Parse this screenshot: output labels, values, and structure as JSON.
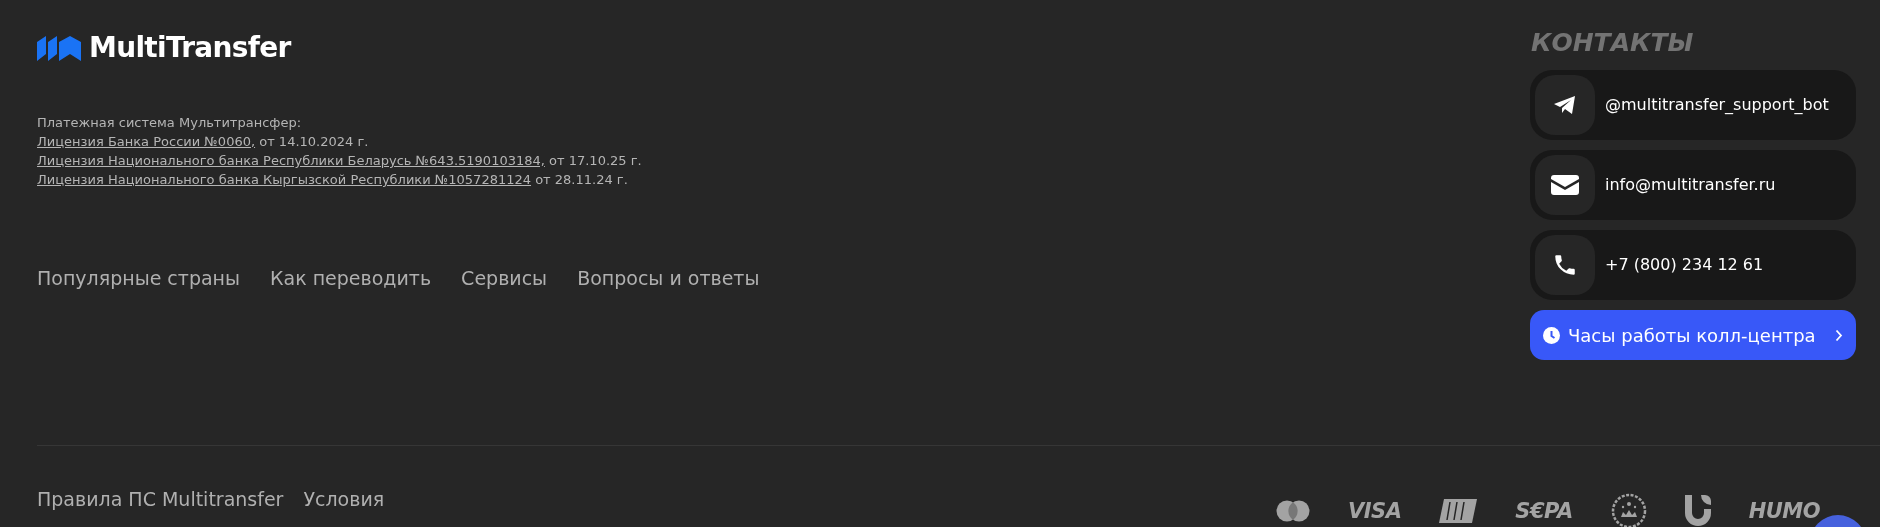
{
  "logo": {
    "text": "MultiTransfer"
  },
  "licenses": {
    "intro": "Платежная система Мультитрансфер:",
    "items": [
      {
        "link": "Лицензия Банка России №0060,",
        "rest": " от 14.10.2024 г."
      },
      {
        "link": "Лицензия Национального банка Республики Беларусь №643.5190103184,",
        "rest": " от 17.10.25 г."
      },
      {
        "link": "Лицензия Национального банка Кыргызской Республики №1057281124",
        "rest": " от 28.11.24 г."
      }
    ]
  },
  "nav": [
    "Популярные страны",
    "Как переводить",
    "Сервисы",
    "Вопросы и ответы"
  ],
  "contacts": {
    "title": "КОНТАКТЫ",
    "items": [
      {
        "kind": "telegram",
        "text": "@multitransfer_support_bot"
      },
      {
        "kind": "email",
        "text": "info@multitransfer.ru"
      },
      {
        "kind": "phone",
        "text": "+7 (800) 234 12 61"
      }
    ],
    "hours_button": "Часы работы колл-центра"
  },
  "bottom_links": [
    "Правила ПС Multitransfer",
    "Условия"
  ],
  "payment_logos": [
    {
      "kind": "mastercard"
    },
    {
      "kind": "wordmark",
      "text": "VISA"
    },
    {
      "kind": "mir"
    },
    {
      "kind": "wordmark",
      "text": "S€PA"
    },
    {
      "kind": "seal"
    },
    {
      "kind": "u"
    },
    {
      "kind": "wordmark",
      "text": "HUMO"
    }
  ]
}
